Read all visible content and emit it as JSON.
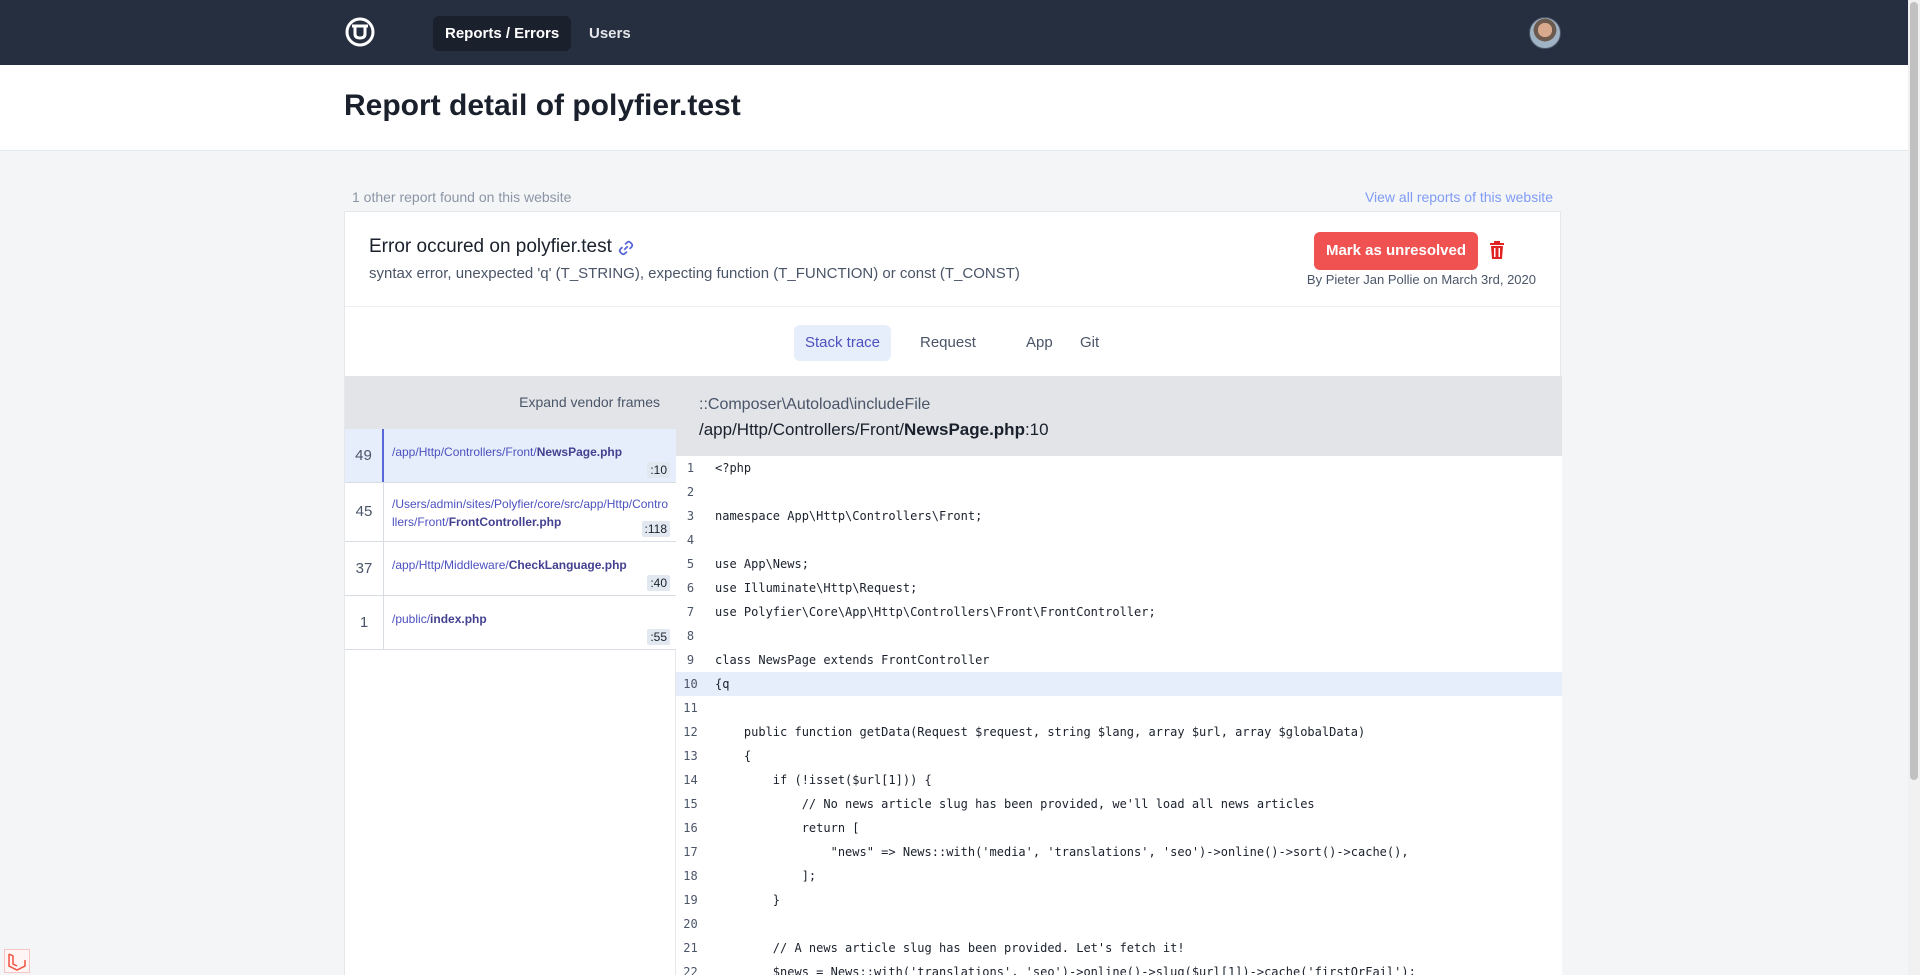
{
  "nav": {
    "logo_icon": "flare-logo-icon",
    "items": [
      {
        "label": "Reports / Errors",
        "active": true
      },
      {
        "label": "Users",
        "active": false
      }
    ],
    "avatar_icon": "user-avatar"
  },
  "page": {
    "title": "Report detail of polyfier.test"
  },
  "meta": {
    "other_reports": "1 other report found on this website",
    "view_all": "View all reports of this website"
  },
  "error": {
    "title": "Error occured on polyfier.test",
    "message": "syntax error, unexpected 'q' (T_STRING), expecting function (T_FUNCTION) or const (T_CONST)",
    "action_label": "Mark as unresolved",
    "byline": "By Pieter Jan Pollie on March 3rd, 2020",
    "colors": {
      "action": "#f05252",
      "delete": "#e02424"
    }
  },
  "tabs": [
    {
      "label": "Stack trace",
      "active": true
    },
    {
      "label": "Request",
      "active": false
    },
    {
      "label": "App",
      "active": false
    },
    {
      "label": "Git",
      "active": false
    }
  ],
  "frames": {
    "expand_label": "Expand vendor frames",
    "items": [
      {
        "num": "49",
        "path_prefix": "/app/Http/Controllers/Front/",
        "file": "NewsPage.php",
        "line": ":10",
        "active": true
      },
      {
        "num": "45",
        "path_prefix": "/Users/admin/sites/Polyfier/core/src/app/Http/Controllers/Front/",
        "file": "FrontController.php",
        "line": ":118",
        "active": false
      },
      {
        "num": "37",
        "path_prefix": "/app/Http/Middleware/",
        "file": "CheckLanguage.php",
        "line": ":40",
        "active": false
      },
      {
        "num": "1",
        "path_prefix": "/public/",
        "file": "index.php",
        "line": ":55",
        "active": false
      }
    ]
  },
  "code": {
    "namespace": "::Composer\\Autoload\\includeFile",
    "file_prefix": "/app/Http/Controllers/Front/",
    "file_name": "NewsPage.php",
    "file_line": ":10",
    "highlight_line": 10,
    "lines": [
      {
        "n": "1",
        "t": "<?php"
      },
      {
        "n": "2",
        "t": ""
      },
      {
        "n": "3",
        "t": "namespace App\\Http\\Controllers\\Front;"
      },
      {
        "n": "4",
        "t": ""
      },
      {
        "n": "5",
        "t": "use App\\News;"
      },
      {
        "n": "6",
        "t": "use Illuminate\\Http\\Request;"
      },
      {
        "n": "7",
        "t": "use Polyfier\\Core\\App\\Http\\Controllers\\Front\\FrontController;"
      },
      {
        "n": "8",
        "t": ""
      },
      {
        "n": "9",
        "t": "class NewsPage extends FrontController"
      },
      {
        "n": "10",
        "t": "{q"
      },
      {
        "n": "11",
        "t": ""
      },
      {
        "n": "12",
        "t": "    public function getData(Request $request, string $lang, array $url, array $globalData)"
      },
      {
        "n": "13",
        "t": "    {"
      },
      {
        "n": "14",
        "t": "        if (!isset($url[1])) {"
      },
      {
        "n": "15",
        "t": "            // No news article slug has been provided, we'll load all news articles"
      },
      {
        "n": "16",
        "t": "            return ["
      },
      {
        "n": "17",
        "t": "                \"news\" => News::with('media', 'translations', 'seo')->online()->sort()->cache(),"
      },
      {
        "n": "18",
        "t": "            ];"
      },
      {
        "n": "19",
        "t": "        }"
      },
      {
        "n": "20",
        "t": ""
      },
      {
        "n": "21",
        "t": "        // A news article slug has been provided. Let's fetch it!"
      },
      {
        "n": "22",
        "t": "        $news = News::with('translations', 'seo')->online()->slug($url[1])->cache('firstOrFail');"
      }
    ]
  }
}
